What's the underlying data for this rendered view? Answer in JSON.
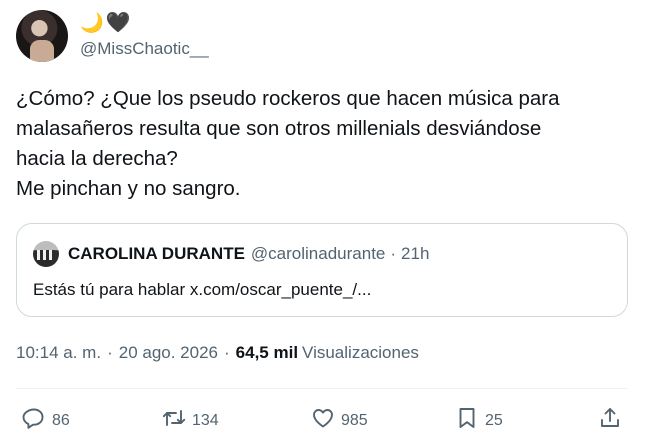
{
  "author": {
    "emoji_moon": "🌙",
    "emoji_heart": "🖤",
    "handle": "@MissChaotic__"
  },
  "tweet": {
    "lines": [
      "¿Cómo? ¿Que los pseudo rockeros que hacen música para",
      "malasañeros resulta que son otros millenials desviándose",
      "hacia la derecha?",
      "Me pinchan y no sangro."
    ]
  },
  "quote": {
    "name": "CAROLINA DURANTE",
    "handle": "@carolinadurante",
    "separator": "·",
    "time": "21h",
    "text": "Estás tú para hablar x.com/oscar_puente_/..."
  },
  "meta": {
    "time": "10:14 a. m.",
    "dot1": "·",
    "date": "20 ago. 2026",
    "dot2": "·",
    "views_count": "64,5 mil",
    "views_label": "Visualizaciones"
  },
  "actions": {
    "reply_count": "86",
    "retweet_count": "134",
    "like_count": "985",
    "bookmark_count": "25"
  },
  "colors": {
    "text": "#0f1419",
    "secondary": "#536471",
    "border": "#cfd9de"
  },
  "icons": [
    "reply-icon",
    "retweet-icon",
    "heart-icon",
    "bookmark-icon",
    "share-icon"
  ]
}
